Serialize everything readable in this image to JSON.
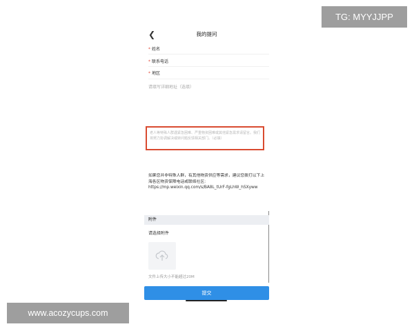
{
  "header": {
    "back_icon": "back-chevron-icon",
    "title": "我的提问"
  },
  "form": {
    "name_label": "姓名",
    "phone_label": "联系电话",
    "region_label": "地区",
    "address_placeholder": "请填写详细地址（选填）",
    "required_mark": "*",
    "highlight_text": "老人等特殊人群遇紧急困难、严重物资困难或其他紧急需求请留言。我们将努力协调解决或转问题反馈相关部门。（必填）",
    "highlight_color": "#d94a2f"
  },
  "notice": {
    "text": "如果您并非特殊人群，有其他物资供应等需求，建议您拨打以下上海各区物资保障电话或联络社区:",
    "link": "https://mp.weixin.qq.com/s/BA8L_tUrF-fgLhW_hSXyww"
  },
  "attachment": {
    "header": "附件",
    "select_label": "请选择附件",
    "upload_icon": "cloud-upload-icon",
    "limit_text": "文件上传大小不能超过20M"
  },
  "submit": {
    "label": "提交",
    "color": "#2f8fe6"
  },
  "watermarks": {
    "top": "TG: MYYJJPP",
    "bottom": "www.acozycups.com"
  }
}
